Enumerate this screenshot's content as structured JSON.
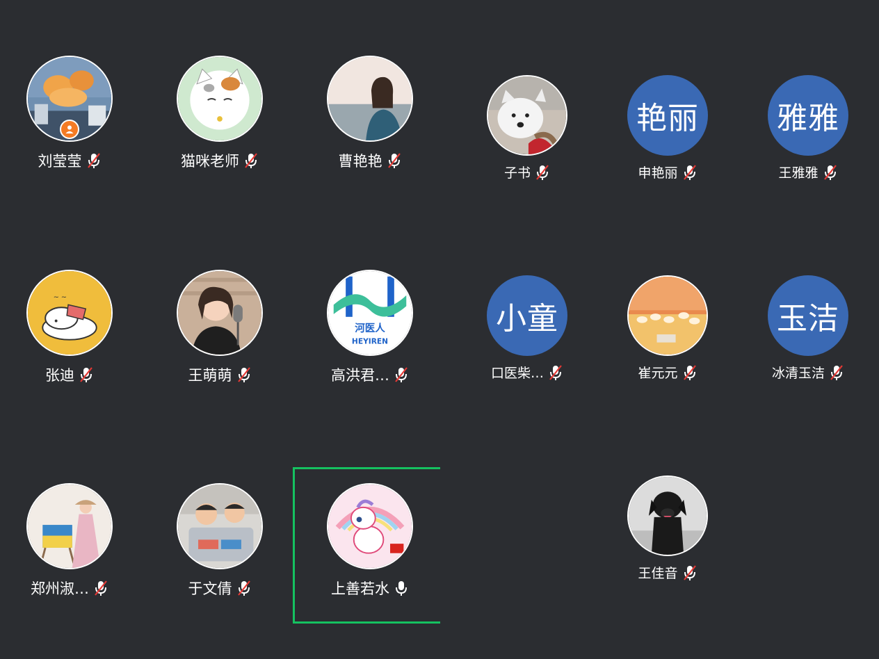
{
  "participants": [
    {
      "name": "刘莹莹",
      "muted": true,
      "host": true,
      "avatar": "photo-sky-clouds"
    },
    {
      "name": "猫咪老师",
      "muted": true,
      "avatar": "cartoon-cat"
    },
    {
      "name": "曹艳艳",
      "muted": true,
      "avatar": "photo-woman-sea"
    },
    {
      "name": "子书",
      "muted": true,
      "avatar": "photo-white-dog"
    },
    {
      "name": "申艳丽",
      "muted": true,
      "avatar_text": "艳丽"
    },
    {
      "name": "王雅雅",
      "muted": true,
      "avatar_text": "雅雅"
    },
    {
      "name": "张迪",
      "muted": true,
      "avatar": "cartoon-sleeping-dog"
    },
    {
      "name": "王萌萌",
      "muted": true,
      "avatar": "photo-girl-microphone"
    },
    {
      "name": "高洪君…",
      "muted": true,
      "avatar": "logo-heyiren",
      "avatar_logo_text": "河医人",
      "avatar_logo_sub": "HEYIREN"
    },
    {
      "name": "口医柴…",
      "muted": true,
      "avatar_text": "小童"
    },
    {
      "name": "崔元元",
      "muted": true,
      "avatar": "painting-sunset-sheep"
    },
    {
      "name": "冰清玉洁",
      "muted": true,
      "avatar_text": "玉洁"
    },
    {
      "name": "郑州淑…",
      "muted": true,
      "avatar": "photo-woman-easel"
    },
    {
      "name": "于文倩",
      "muted": true,
      "avatar": "photo-two-kids"
    },
    {
      "name": "上善若水",
      "muted": false,
      "speaking": true,
      "avatar": "cartoon-unicorn"
    },
    {
      "name": "王佳音",
      "muted": true,
      "avatar": "photo-black-dog"
    }
  ],
  "colors": {
    "background": "#2b2d31",
    "text_avatar": "#3a69b4",
    "speaking_frame": "#15c160",
    "muted_slash": "#e53935",
    "host_badge": "#f47b24"
  }
}
